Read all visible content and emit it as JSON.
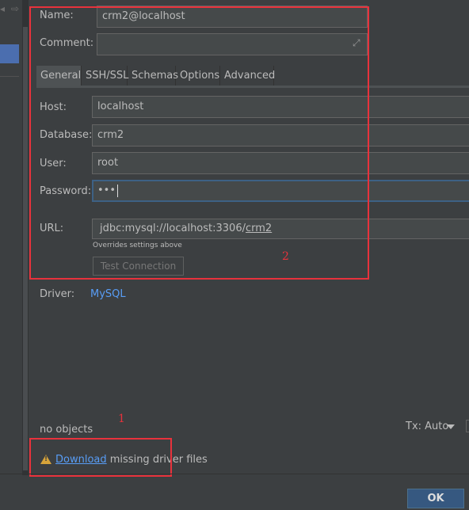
{
  "form": {
    "name_label": "Name:",
    "name_value": "crm2@localhost",
    "comment_label": "Comment:",
    "comment_value": "",
    "tabs": [
      {
        "label": "General"
      },
      {
        "label": "SSH/SSL"
      },
      {
        "label": "Schemas"
      },
      {
        "label": "Options"
      },
      {
        "label": "Advanced"
      }
    ],
    "host_label": "Host:",
    "host_value": "localhost",
    "database_label": "Database:",
    "database_value": "crm2",
    "user_label": "User:",
    "user_value": "root",
    "password_label": "Password:",
    "password_value": "•••",
    "url_label": "URL:",
    "url_prefix": "jdbc:mysql://localhost:3306/",
    "url_db": "crm2",
    "url_hint": "Overrides settings above",
    "test_button": "Test Connection",
    "driver_label": "Driver:",
    "driver_value": "MySQL"
  },
  "status": {
    "objects": "no objects",
    "tx": "Tx: Auto",
    "download_link": "Download",
    "download_rest": " missing driver files"
  },
  "annotations": {
    "marker_1": "1",
    "marker_2": "2"
  },
  "footer": {
    "ok_label": "OK"
  },
  "colors": {
    "background": "#3c3f41",
    "link": "#589df6",
    "annotation": "#e8323c",
    "ok_button": "#365880"
  }
}
